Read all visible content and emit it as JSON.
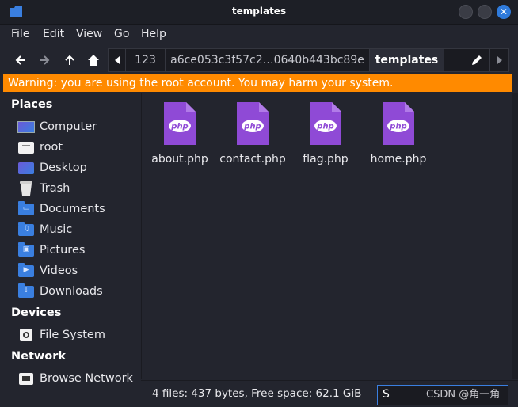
{
  "window": {
    "title": "templates"
  },
  "menu": [
    "File",
    "Edit",
    "View",
    "Go",
    "Help"
  ],
  "toolbar": {
    "path_segments": [
      "123",
      "a6ce053c3f57c2…0640b443bc89e",
      "templates"
    ]
  },
  "warning": "Warning: you are using the root account. You may harm your system.",
  "sidebar": {
    "places_title": "Places",
    "places": [
      "Computer",
      "root",
      "Desktop",
      "Trash",
      "Documents",
      "Music",
      "Pictures",
      "Videos",
      "Downloads"
    ],
    "devices_title": "Devices",
    "devices": [
      "File System"
    ],
    "network_title": "Network",
    "network": [
      "Browse Network"
    ]
  },
  "files": [
    "about.php",
    "contact.php",
    "flag.php",
    "home.php"
  ],
  "file_icon_text": "php",
  "status": {
    "text": "4 files: 437 bytes, Free space: 62.1 GiB",
    "search_value": "S"
  },
  "watermark": "CSDN @角一角",
  "colors": {
    "accent": "#3a7fe0",
    "warning": "#ff8a00",
    "php": "#8f4ad6"
  }
}
